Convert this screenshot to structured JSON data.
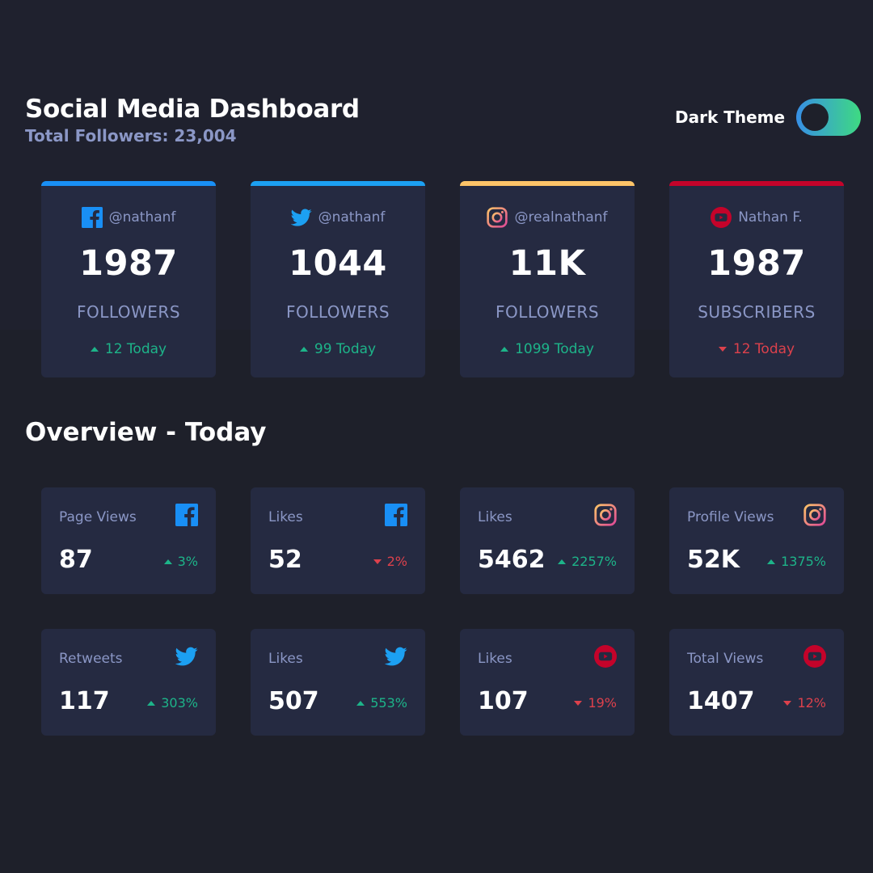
{
  "header": {
    "title": "Social Media Dashboard",
    "total_followers": "Total Followers: 23,004",
    "theme_label": "Dark Theme",
    "theme_toggle": {
      "state": "dark",
      "gradient": [
        "#378fe6",
        "#3eda82"
      ]
    }
  },
  "colors": {
    "background": "#1e202a",
    "card": "#252a41",
    "muted_text": "#8b97c6",
    "up": "#1db489",
    "down": "#dc414c",
    "facebook": "#198ff5",
    "twitter": "#1ca0f2",
    "instagram": [
      "#fdc468",
      "#df4996"
    ],
    "youtube": "#c4032a"
  },
  "follower_cards": [
    {
      "platform": "facebook",
      "icon": "facebook-icon",
      "handle": "@nathanf",
      "count": "1987",
      "unit": "FOLLOWERS",
      "today": "12 Today",
      "trend": "up"
    },
    {
      "platform": "twitter",
      "icon": "twitter-icon",
      "handle": "@nathanf",
      "count": "1044",
      "unit": "FOLLOWERS",
      "today": "99 Today",
      "trend": "up"
    },
    {
      "platform": "instagram",
      "icon": "instagram-icon",
      "handle": "@realnathanf",
      "count": "11K",
      "unit": "FOLLOWERS",
      "today": "1099 Today",
      "trend": "up"
    },
    {
      "platform": "youtube",
      "icon": "youtube-icon",
      "handle": "Nathan F.",
      "count": "1987",
      "unit": "SUBSCRIBERS",
      "today": "12 Today",
      "trend": "down"
    }
  ],
  "overview": {
    "title": "Overview - Today",
    "items": [
      {
        "label": "Page Views",
        "icon": "facebook-icon",
        "value": "87",
        "change": "3%",
        "trend": "up"
      },
      {
        "label": "Likes",
        "icon": "facebook-icon",
        "value": "52",
        "change": "2%",
        "trend": "down"
      },
      {
        "label": "Likes",
        "icon": "instagram-icon",
        "value": "5462",
        "change": "2257%",
        "trend": "up"
      },
      {
        "label": "Profile Views",
        "icon": "instagram-icon",
        "value": "52K",
        "change": "1375%",
        "trend": "up"
      },
      {
        "label": "Retweets",
        "icon": "twitter-icon",
        "value": "117",
        "change": "303%",
        "trend": "up"
      },
      {
        "label": "Likes",
        "icon": "twitter-icon",
        "value": "507",
        "change": "553%",
        "trend": "up"
      },
      {
        "label": "Likes",
        "icon": "youtube-icon",
        "value": "107",
        "change": "19%",
        "trend": "down"
      },
      {
        "label": "Total Views",
        "icon": "youtube-icon",
        "value": "1407",
        "change": "12%",
        "trend": "down"
      }
    ]
  }
}
